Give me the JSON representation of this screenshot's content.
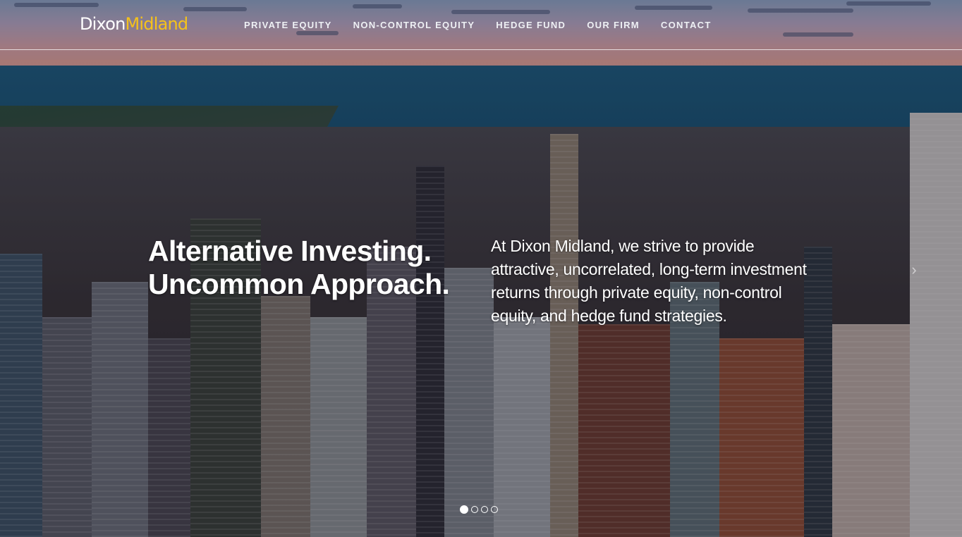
{
  "brand": {
    "part1": "Dixon",
    "part2": "Midland",
    "accent_color": "#f5c21b"
  },
  "nav": {
    "items": [
      {
        "label": "PRIVATE EQUITY"
      },
      {
        "label": "NON-CONTROL EQUITY"
      },
      {
        "label": "HEDGE FUND"
      },
      {
        "label": "OUR FIRM"
      },
      {
        "label": "CONTACT"
      }
    ]
  },
  "hero": {
    "headline_line1": "Alternative Investing.",
    "headline_line2": "Uncommon Approach.",
    "blurb": "At Dixon Midland, we strive to provide attractive, uncorrelated, long-term investment returns through private equity, non-control equity, and hedge fund strategies.",
    "next_icon": "chevron-right-icon",
    "next_glyph": "›"
  },
  "carousel": {
    "slide_count": 4,
    "active_index": 0
  }
}
